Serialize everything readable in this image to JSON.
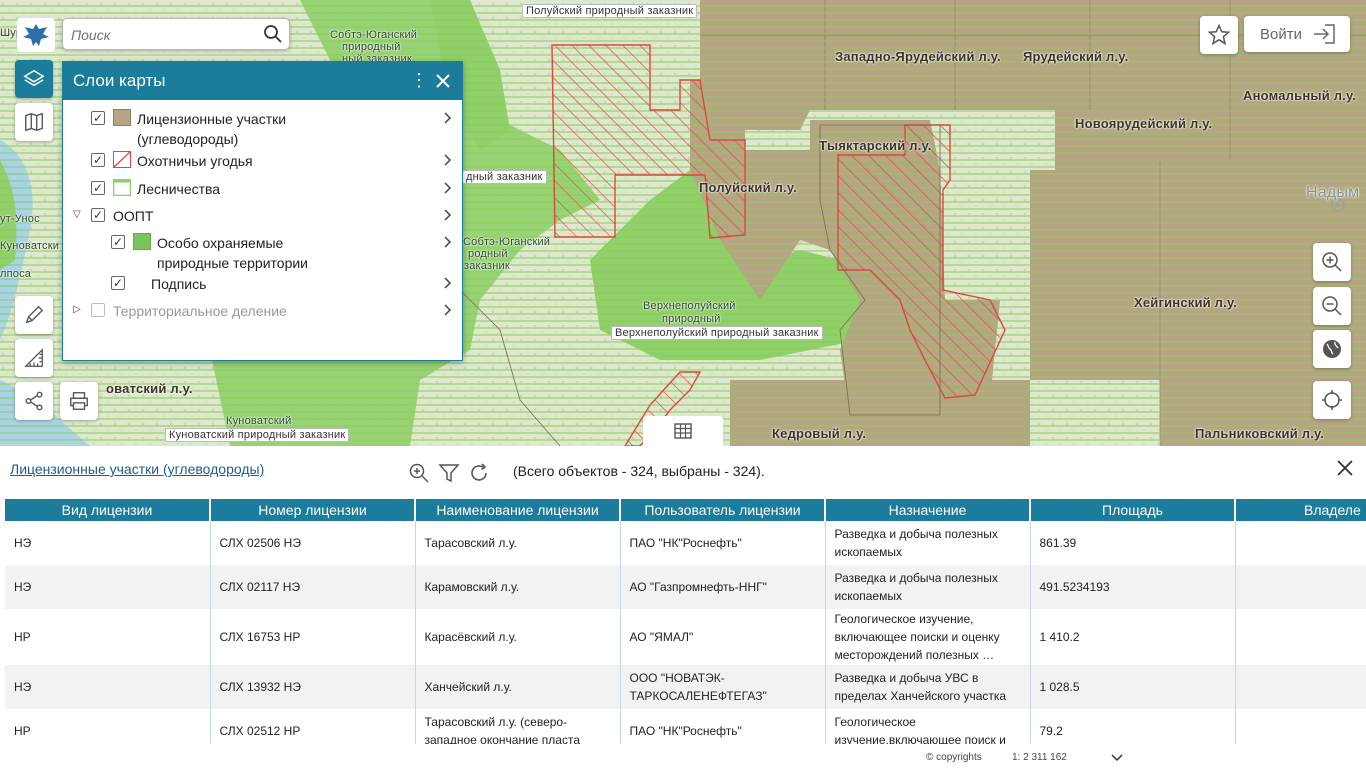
{
  "search": {
    "placeholder": "Поиск"
  },
  "login": {
    "label": "Войти"
  },
  "layers_panel": {
    "title": "Слои карты",
    "items": [
      {
        "label": "Лицензионные участки",
        "label2": "(углеводороды)"
      },
      {
        "label": "Охотничьи угодья"
      },
      {
        "label": "Лесничества"
      },
      {
        "label": "ООПТ"
      },
      {
        "label": "Особо охраняемые",
        "label2": "природные территории"
      },
      {
        "label": "Подпись"
      },
      {
        "label": "Территориальное деление"
      }
    ]
  },
  "map_labels": {
    "zapadno_yarudeisky": "Западно-Ярудейский л.у.",
    "yarudeisky": "Ярудейский л.у.",
    "anomalny": "Аномальный л.у.",
    "novoyarudeisky": "Новоярудейский л.у.",
    "tyaktarsky": "Тыяктарский л.у.",
    "poluisky": "Полуйский л.у.",
    "kheiginsky": "Хейгинский л.у.",
    "kedrovy": "Кедровый л.у.",
    "palnikovsky": "Пальниковский л.у.",
    "novatsky": "оватский л.у.",
    "nadym": "Надым",
    "verkhnepoluisky_box": "Верхнеполуйский природный заказник",
    "verkhnepoluisky_1": "Верхнеполуйский",
    "verkhnepoluisky_2": "природный",
    "poluisky_zakaznik": "Полуйский природный заказник",
    "dny_zakaznik": "дный заказник",
    "kunovatsky_zakaznik": "Куноватский природный заказник",
    "kunovatsky_small": "Куноватский",
    "surgut": "Шур",
    "yugan1": "Собтэ-Юганский",
    "yugan2": "природный",
    "yugan3": "ный заказник",
    "yugan4": "Собтэ-Юганский",
    "yugan5": "родный",
    "yugan6": "заказник",
    "kunovatski_left": "Куноватски",
    "unos": "ут-Унос",
    "lposa": "лпоса"
  },
  "table_panel": {
    "title": "Лицензионные участки (углеводороды)",
    "count": "(Всего объектов - 324, выбраны - 324).",
    "columns": [
      "Вид лицензии",
      "Номер лицензии",
      "Наименование лицензии",
      "Пользователь лицензии",
      "Назначение",
      "Площадь",
      "Владеле"
    ],
    "rows": [
      {
        "vid": "НЭ",
        "nomer": "СЛХ 02506 НЭ",
        "name": "Тарасовский л.у.",
        "user": "ПАО \"НК\"Роснефть\"",
        "purpose": "Разведка и добыча полезных ископаемых",
        "area": "861.39",
        "owner": ""
      },
      {
        "vid": "НЭ",
        "nomer": "СЛХ 02117 НЭ",
        "name": "Карамовский л.у.",
        "user": "АО \"Газпромнефть-ННГ\"",
        "purpose": "Разведка и добыча полезных ископаемых",
        "area": "491.5234193",
        "owner": ""
      },
      {
        "vid": "НР",
        "nomer": "СЛХ 16753 НР",
        "name": "Карасёвский л.у.",
        "user": "АО \"ЯМАЛ\"",
        "purpose": "Геологическое изучение, включающее поиски и оценку месторождений полезных …",
        "area": "1 410.2",
        "owner": ""
      },
      {
        "vid": "НЭ",
        "nomer": "СЛХ 13932 НЭ",
        "name": "Ханчейский л.у.",
        "user": "ООО \"НОВАТЭК-ТАРКОСАЛЕНЕФТЕГАЗ\"",
        "purpose": "Разведка и добыча УВС в пределах Ханчейского участка",
        "area": "1 028.5",
        "owner": ""
      },
      {
        "vid": "НР",
        "nomer": "СЛХ 02512 НР",
        "name": "Тарасовский л.у. (северо-западное окончание пласта",
        "user": "ПАО \"НК\"Роснефть\"",
        "purpose": "Геологическое изучение,включающее поиск и",
        "area": "79.2",
        "owner": ""
      }
    ]
  },
  "footer": {
    "copyright": "© copyrights",
    "scale": "1: 2 311 162"
  },
  "colors": {
    "accent": "#1b7c9c",
    "license_area": "#b7a385",
    "hunting": "#e0453e",
    "forest": "#8ecf64",
    "protected": "#7bc35a"
  }
}
